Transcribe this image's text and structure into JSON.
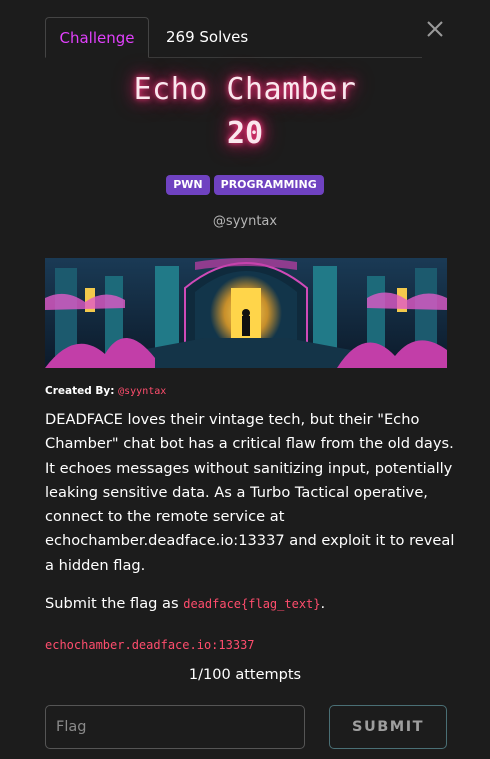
{
  "tabs": [
    {
      "label": "Challenge",
      "active": true
    },
    {
      "label": "269 Solves",
      "active": false
    }
  ],
  "challenge": {
    "name": "Echo Chamber",
    "points": "20",
    "tags": [
      "PWN",
      "PROGRAMMING"
    ],
    "author": "@syyntax"
  },
  "created_by": {
    "label": "Created By:",
    "handle": "@syyntax"
  },
  "description": "DEADFACE loves their vintage tech, but their \"Echo Chamber\" chat bot has a critical flaw from the old days. It echoes messages without sanitizing input, potentially leaking sensitive data. As a Turbo Tactical operative, connect to the remote service at echochamber.deadface.io:13337 and exploit it to reveal a hidden flag.",
  "submit_note": {
    "prefix": "Submit the flag as ",
    "code": "deadface{flag_text}",
    "suffix": "."
  },
  "endpoint": "echochamber.deadface.io:13337",
  "attempts": "1/100 attempts",
  "form": {
    "flag_placeholder": "Flag",
    "flag_value": "",
    "submit_label": "SUBMIT"
  },
  "colors": {
    "accent_tab": "#e040fb",
    "tag_bg": "#6f42c1",
    "code": "#ff4d6d",
    "title_glow": "#ff3d7f"
  },
  "icons": [
    "close-icon"
  ]
}
